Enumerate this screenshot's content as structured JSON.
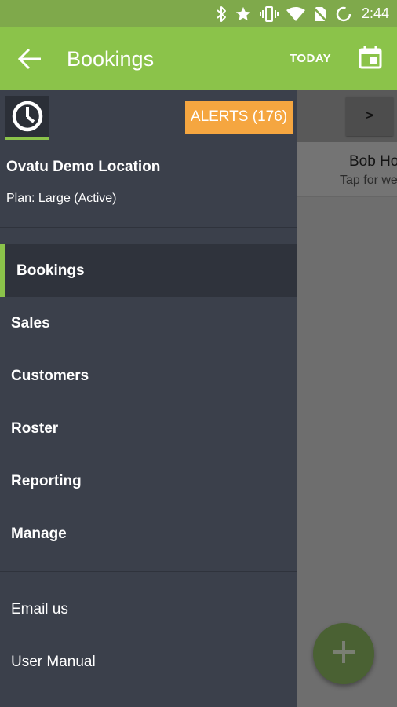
{
  "status_bar": {
    "time": "2:44",
    "icons": [
      "bluetooth-icon",
      "star-icon",
      "vibrate-icon",
      "wifi-icon",
      "no-sim-icon",
      "loading-icon"
    ]
  },
  "app_bar": {
    "title": "Bookings",
    "today_label": "TODAY",
    "icons": [
      "back-arrow-icon",
      "calendar-icon"
    ]
  },
  "background": {
    "next_label": ">",
    "staff_name": "Bob Ho",
    "staff_sub": "Tap for we",
    "fab_icon": "plus-icon"
  },
  "drawer": {
    "logo_icon": "clock-icon",
    "alerts_label": "ALERTS (176)",
    "location_name": "Ovatu Demo Location",
    "plan": "Plan: Large (Active)",
    "nav_items": [
      {
        "label": "Bookings",
        "active": true
      },
      {
        "label": "Sales"
      },
      {
        "label": "Customers"
      },
      {
        "label": "Roster"
      },
      {
        "label": "Reporting"
      },
      {
        "label": "Manage"
      }
    ],
    "footer_items": [
      {
        "label": "Email us"
      },
      {
        "label": "User Manual"
      }
    ]
  },
  "colors": {
    "primary": "#8bc34a",
    "status_bar": "#7fa94b",
    "drawer_bg": "#3b404b",
    "active_item_bg": "#2f333c",
    "alerts": "#f5a640"
  }
}
